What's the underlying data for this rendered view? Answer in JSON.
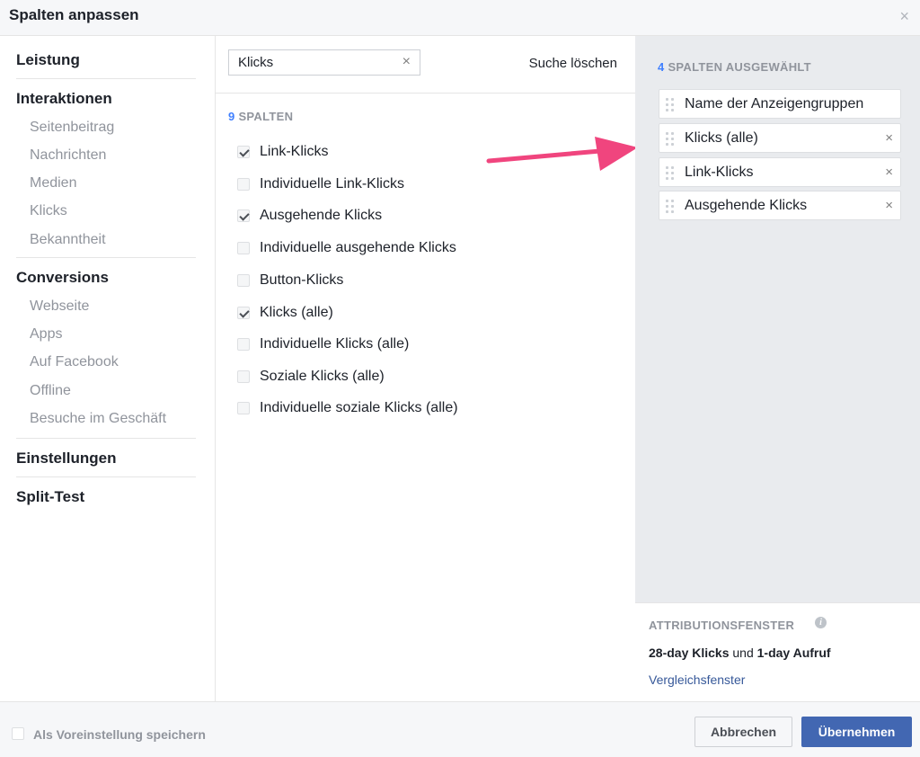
{
  "dialog": {
    "title": "Spalten anpassen",
    "close_glyph": "×"
  },
  "nav": {
    "sections": [
      {
        "label": "Leistung",
        "items": []
      },
      {
        "label": "Interaktionen",
        "items": [
          "Seitenbeitrag",
          "Nachrichten",
          "Medien",
          "Klicks",
          "Bekanntheit"
        ]
      },
      {
        "label": "Conversions",
        "items": [
          "Webseite",
          "Apps",
          "Auf Facebook",
          "Offline",
          "Besuche im Geschäft"
        ]
      },
      {
        "label": "Einstellungen",
        "items": []
      },
      {
        "label": "Split-Test",
        "items": []
      }
    ]
  },
  "search": {
    "value": "Klicks",
    "clear_glyph": "×",
    "clear_label": "Suche löschen"
  },
  "results": {
    "count": "9",
    "count_label": "SPALTEN",
    "options": [
      {
        "label": "Link-Klicks",
        "checked": true
      },
      {
        "label": "Individuelle Link-Klicks",
        "checked": false
      },
      {
        "label": "Ausgehende Klicks",
        "checked": true
      },
      {
        "label": "Individuelle ausgehende Klicks",
        "checked": false
      },
      {
        "label": "Button-Klicks",
        "checked": false
      },
      {
        "label": "Klicks (alle)",
        "checked": true
      },
      {
        "label": "Individuelle Klicks (alle)",
        "checked": false
      },
      {
        "label": "Soziale Klicks (alle)",
        "checked": false
      },
      {
        "label": "Individuelle soziale Klicks (alle)",
        "checked": false
      }
    ]
  },
  "selected": {
    "count": "4",
    "count_label": "SPALTEN AUSGEWÄHLT",
    "items": [
      {
        "label": "Name der Anzeigengruppen",
        "removable": false
      },
      {
        "label": "Klicks (alle)",
        "removable": true
      },
      {
        "label": "Link-Klicks",
        "removable": true
      },
      {
        "label": "Ausgehende Klicks",
        "removable": true
      }
    ],
    "remove_glyph": "×"
  },
  "attribution": {
    "heading": "ATTRIBUTIONSFENSTER",
    "info_glyph": "i",
    "part1": "28-day Klicks",
    "conj": " und ",
    "part2": "1-day Aufruf",
    "link": "Vergleichsfenster"
  },
  "footer": {
    "save_default_label": "Als Voreinstellung speichern",
    "cancel_label": "Abbrechen",
    "apply_label": "Übernehmen"
  },
  "colors": {
    "accent": "#4080ff",
    "primary_button": "#4267b2",
    "annotation_arrow": "#f0457e"
  }
}
